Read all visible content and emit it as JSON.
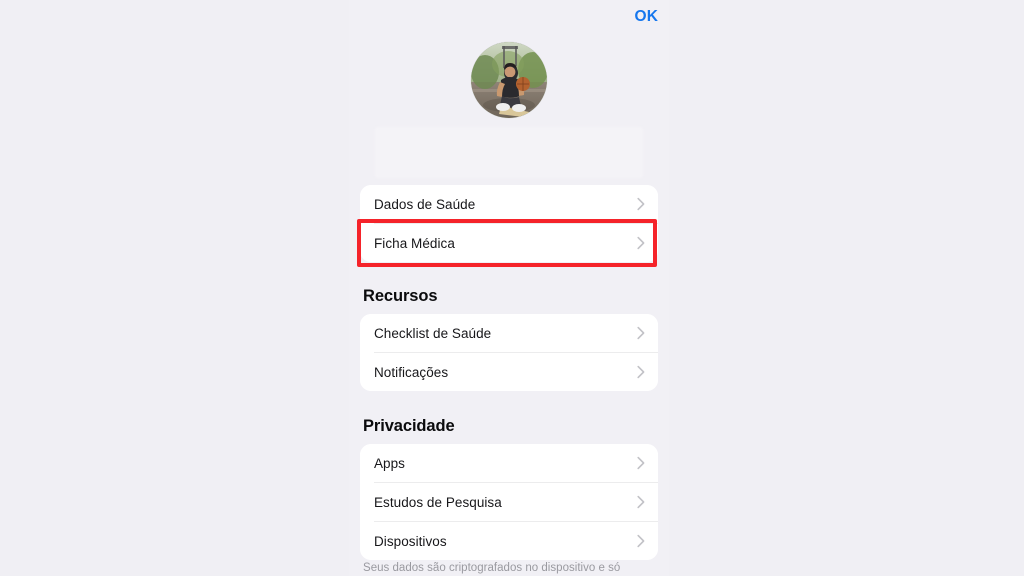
{
  "app": {
    "background_color": "#f0eff4",
    "sheet_background_color": "#f1f0f5",
    "accent_color": "#1677ee",
    "highlight_color": "#f5232a"
  },
  "navbar": {
    "ok_label": "OK"
  },
  "profile": {
    "avatar_alt": "user-profile-photo",
    "name_value": "",
    "name_placeholder": ""
  },
  "sections": [
    {
      "header": "",
      "rows": [
        {
          "label": "Dados de Saúde",
          "highlighted": false
        },
        {
          "label": "Ficha Médica",
          "highlighted": true
        }
      ]
    },
    {
      "header": "Recursos",
      "rows": [
        {
          "label": "Checklist de Saúde",
          "highlighted": false
        },
        {
          "label": "Notificações",
          "highlighted": false
        }
      ]
    },
    {
      "header": "Privacidade",
      "rows": [
        {
          "label": "Apps",
          "highlighted": false
        },
        {
          "label": "Estudos de Pesquisa",
          "highlighted": false
        },
        {
          "label": "Dispositivos",
          "highlighted": false
        }
      ]
    }
  ],
  "footer": {
    "note": "Seus dados são criptografados no dispositivo e só"
  },
  "icons": {
    "chevron": "chevron-right-icon"
  }
}
